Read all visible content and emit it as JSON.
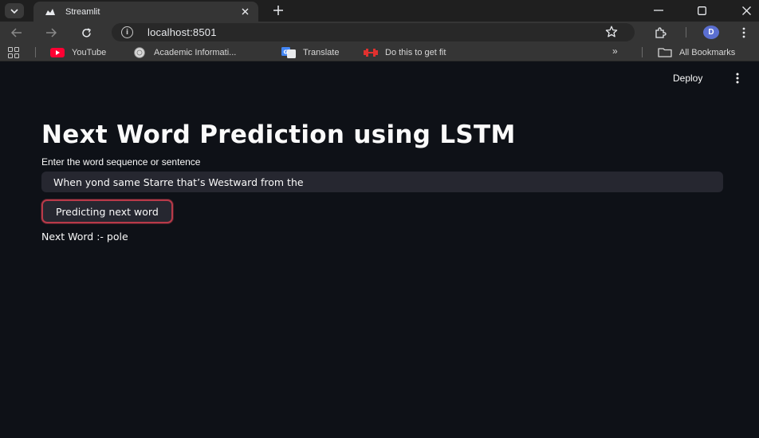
{
  "browser": {
    "tab_title": "Streamlit",
    "url": "localhost:8501",
    "profile_initial": "D",
    "bookmarks": [
      {
        "label": "YouTube",
        "icon": "youtube-icon"
      },
      {
        "label": "Academic Informati...",
        "icon": "academic-icon"
      },
      {
        "label": "Translate",
        "icon": "translate-icon"
      },
      {
        "label": "Do this to get fit",
        "icon": "fitness-icon"
      }
    ],
    "more_bookmarks": "»",
    "all_bookmarks": "All Bookmarks"
  },
  "app": {
    "deploy_label": "Deploy",
    "title": "Next Word Prediction using LSTM",
    "input_label": "Enter the word sequence or sentence",
    "input_value": "When yond same Starre that’s Westward from the",
    "button_label": "Predicting next word",
    "result": "Next Word :- pole"
  },
  "colors": {
    "background": "#0e1117",
    "input_bg": "#262730",
    "button_border": "#b83a49",
    "profile": "#5b6fd1"
  }
}
